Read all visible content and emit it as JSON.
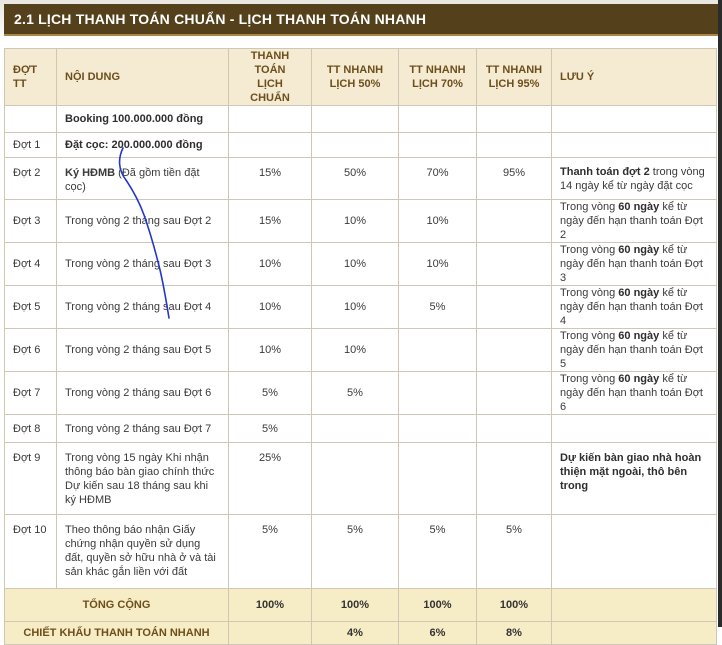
{
  "title": "2.1 LỊCH THANH TOÁN CHUẨN - LỊCH THANH TOÁN NHANH",
  "headers": {
    "dot": "ĐỢT TT",
    "noidung": "NỘI DUNG",
    "std_1": "THANH TOÁN",
    "std_2": "LỊCH CHUẨN",
    "n50_1": "TT NHANH",
    "n50_2": "LỊCH 50%",
    "n70_1": "TT NHANH",
    "n70_2": "LỊCH 70%",
    "n95_1": "TT NHANH",
    "n95_2": "LỊCH 95%",
    "note": "LƯU Ý"
  },
  "rows": [
    {
      "dot": "",
      "content": "Booking 100.000.000 đồng",
      "std": "",
      "n50": "",
      "n70": "",
      "n95": ""
    },
    {
      "dot": "Đợt 1",
      "content": "Đặt cọc: 200.000.000 đồng",
      "std": "",
      "n50": "",
      "n70": "",
      "n95": ""
    },
    {
      "dot": "Đợt 2",
      "content_b": "Ký HĐMB",
      "content": " (Đã gồm tiền đặt cọc)",
      "std": "15%",
      "n50": "50%",
      "n70": "70%",
      "n95": "95%",
      "note_b": "Thanh toán đợt 2",
      "note": " trong vòng 14 ngày kể từ ngày đặt cọc"
    },
    {
      "dot": "Đợt 3",
      "content": "Trong vòng 2 tháng sau Đợt 2",
      "std": "15%",
      "n50": "10%",
      "n70": "10%",
      "n95": "",
      "note_a": "Trong vòng ",
      "note_b": "60 ngày",
      "note": " kể từ ngày đến hạn thanh toán Đợt 2"
    },
    {
      "dot": "Đợt 4",
      "content": "Trong vòng 2 tháng sau Đợt 3",
      "std": "10%",
      "n50": "10%",
      "n70": "10%",
      "n95": "",
      "note_a": "Trong vòng ",
      "note_b": "60 ngày",
      "note": " kể từ ngày đến hạn thanh toán Đợt 3"
    },
    {
      "dot": "Đợt 5",
      "content": "Trong vòng 2 tháng sau Đợt 4",
      "std": "10%",
      "n50": "10%",
      "n70": "5%",
      "n95": "",
      "note_a": "Trong vòng ",
      "note_b": "60 ngày",
      "note": " kể từ ngày đến hạn thanh toán Đợt 4"
    },
    {
      "dot": "Đợt 6",
      "content": "Trong vòng 2 tháng sau Đợt 5",
      "std": "10%",
      "n50": "10%",
      "n70": "",
      "n95": "",
      "note_a": "Trong vòng ",
      "note_b": "60 ngày",
      "note": " kể từ ngày đến hạn thanh toán Đợt 5"
    },
    {
      "dot": "Đợt 7",
      "content": "Trong vòng 2 tháng sau Đợt 6",
      "std": "5%",
      "n50": "5%",
      "n70": "",
      "n95": "",
      "note_a": "Trong vòng ",
      "note_b": "60 ngày",
      "note": " kể từ ngày đến hạn thanh toán Đợt 6"
    },
    {
      "dot": "Đợt 8",
      "content": "Trong vòng 2 tháng sau Đợt 7",
      "std": "5%",
      "n50": "",
      "n70": "",
      "n95": ""
    },
    {
      "dot": "Đợt 9",
      "content": "Trong vòng 15 ngày Khi nhận thông báo bàn giao chính thức Dự kiến sau 18 tháng sau khi ký HĐMB",
      "std": "25%",
      "n50": "",
      "n70": "",
      "n95": "",
      "note_b": "Dự kiến bàn giao nhà hoàn thiện mặt ngoài, thô bên trong"
    },
    {
      "dot": "Đợt 10",
      "content": "Theo thông báo nhận Giấy chứng nhận quyền sử dụng đất, quyền sở hữu nhà ở và tài sản khác gắn liền với đất",
      "std": "5%",
      "n50": "5%",
      "n70": "5%",
      "n95": "5%"
    }
  ],
  "total": {
    "label": "TỔNG CỘNG",
    "std": "100%",
    "n50": "100%",
    "n70": "100%",
    "n95": "100%"
  },
  "discount": {
    "label": "CHIẾT KHẤU THANH TOÁN NHANH",
    "std": "",
    "n50": "4%",
    "n70": "6%",
    "n95": "8%"
  }
}
